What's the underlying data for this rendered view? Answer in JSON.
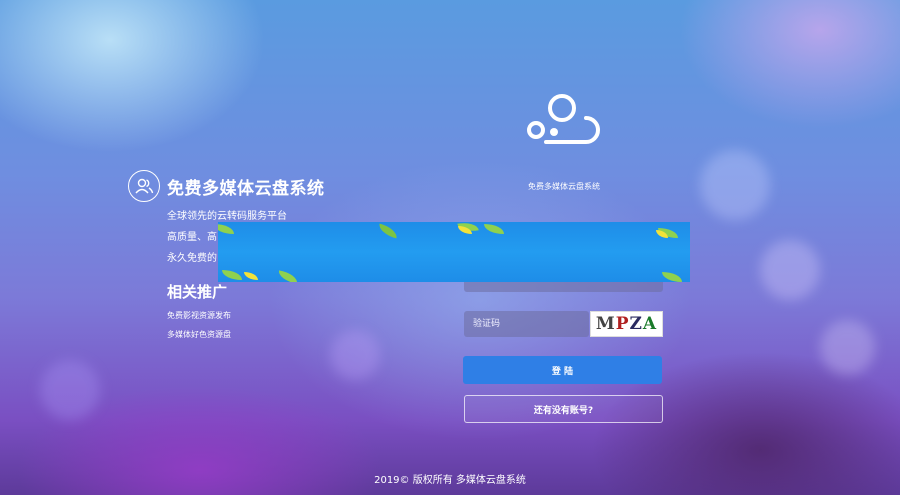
{
  "promo": {
    "title": "免费多媒体云盘系统",
    "lines": [
      "全球领先的云转码服务平台",
      "高质量、高",
      "永久免费的"
    ],
    "recommend_title": "相关推广",
    "recommend_items": [
      "免费影视资源发布",
      "多媒体好色资源盘"
    ]
  },
  "login": {
    "brand": "免费多媒体云盘系统",
    "captcha_placeholder": "验证码",
    "captcha_chars": [
      "M",
      "P",
      "Z",
      "A"
    ],
    "login_label": "登 陆",
    "register_label": "还有没有账号?"
  },
  "footer": {
    "copyright": "2019© 版权所有 多媒体云盘系统"
  },
  "colors": {
    "accent": "#2f7fe6",
    "banner": "#1e8de8"
  },
  "icons": {
    "user": "users-icon",
    "logo": "cloud-logo-icon"
  }
}
